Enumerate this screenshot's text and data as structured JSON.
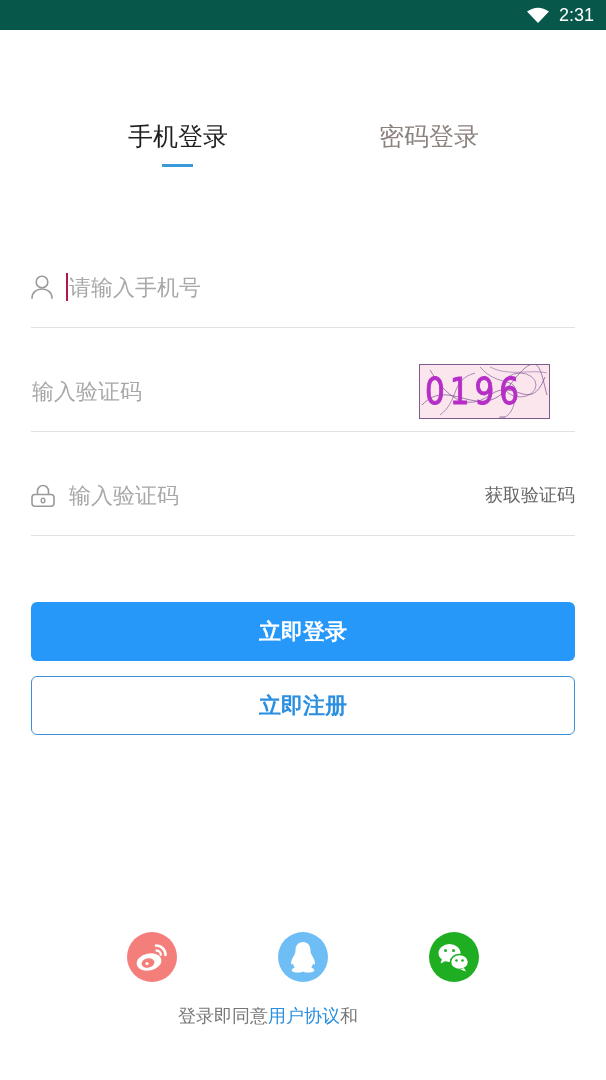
{
  "status_bar": {
    "time": "2:31"
  },
  "tabs": [
    {
      "label": "手机登录",
      "selected": true
    },
    {
      "label": "密码登录",
      "selected": false
    }
  ],
  "fields": [
    {
      "kind": "phone",
      "placeholder": "请输入手机号",
      "focused": true
    },
    {
      "kind": "captcha",
      "placeholder": "输入验证码",
      "focused": false,
      "captcha": "0196"
    },
    {
      "kind": "sms_code",
      "placeholder": "输入验证码",
      "focused": false,
      "action": "获取验证码"
    }
  ],
  "buttons": [
    {
      "kind": "primary",
      "label": "立即登录"
    },
    {
      "kind": "outline",
      "label": "立即注册"
    }
  ],
  "agreement": {
    "text": "登录即同意",
    "link": "用户协议",
    "text_after": "和"
  }
}
